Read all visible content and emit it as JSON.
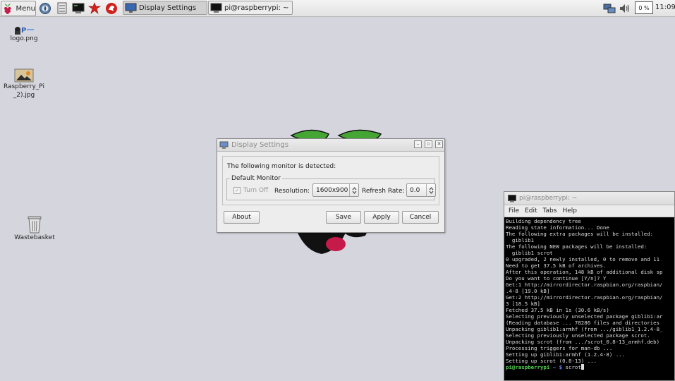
{
  "taskbar": {
    "menu_label": "Menu",
    "launchers": [
      "browser-icon",
      "file-manager-icon",
      "terminal-icon",
      "math-kernel-icon",
      "wolfram-icon"
    ],
    "tasks": [
      {
        "label": "Display Settings",
        "active": true,
        "icon": "monitor-icon"
      },
      {
        "label": "pi@raspberrypi: ~",
        "active": false,
        "icon": "terminal-icon"
      }
    ],
    "tray": {
      "network_icon": "network-icon",
      "volume_icon": "volume-icon",
      "cpu_usage": "0 %",
      "clock": "11:09"
    }
  },
  "desktop": {
    "icons": [
      {
        "label": "logo.png",
        "icon": "image-file-icon"
      },
      {
        "label_line1": "Raspberry_Pi",
        "label_line2": "_2).jpg",
        "icon": "image-file-icon"
      },
      {
        "label": "Wastebasket",
        "icon": "trash-icon"
      }
    ]
  },
  "display_settings": {
    "title": "Display Settings",
    "detected_text": "The following monitor is detected:",
    "frame_label": "Default Monitor",
    "turn_off_label": "Turn Off",
    "turn_off_checked": true,
    "resolution_label": "Resolution:",
    "resolution_value": "1600x900",
    "refresh_label": "Refresh Rate:",
    "refresh_value": "0.0",
    "buttons": {
      "about": "About",
      "save": "Save",
      "apply": "Apply",
      "cancel": "Cancel"
    }
  },
  "terminal": {
    "title": "pi@raspberrypi: ~",
    "menu": [
      "File",
      "Edit",
      "Tabs",
      "Help"
    ],
    "lines": [
      "Building dependency tree",
      "Reading state information... Done",
      "The following extra packages will be installed:",
      "  giblib1",
      "The following NEW packages will be installed:",
      "  giblib1 scrot",
      "0 upgraded, 2 newly installed, 0 to remove and 11",
      "Need to get 37.5 kB of archives.",
      "After this operation, 148 kB of additional disk sp",
      "Do you want to continue [Y/n]? Y",
      "Get:1 http://mirrordirector.raspbian.org/raspbian/",
      ".4-8 [19.0 kB]",
      "Get:2 http://mirrordirector.raspbian.org/raspbian/",
      "3 [18.5 kB]",
      "Fetched 37.5 kB in 1s (30.6 kB/s)",
      "Selecting previously unselected package giblib1:ar",
      "(Reading database ... 78286 files and directories",
      "Unpacking giblib1:armhf (from .../giblib1_1.2.4-8_",
      "Selecting previously unselected package scrot.",
      "Unpacking scrot (from .../scrot_0.8-13_armhf.deb)",
      "Processing triggers for man-db ...",
      "Setting up giblib1:armhf (1.2.4-8) ...",
      "Setting up scrot (0.8-13) ..."
    ],
    "prompt_user": "pi@raspberrypi",
    "prompt_dir": " ~ $ ",
    "command": "scrot"
  }
}
